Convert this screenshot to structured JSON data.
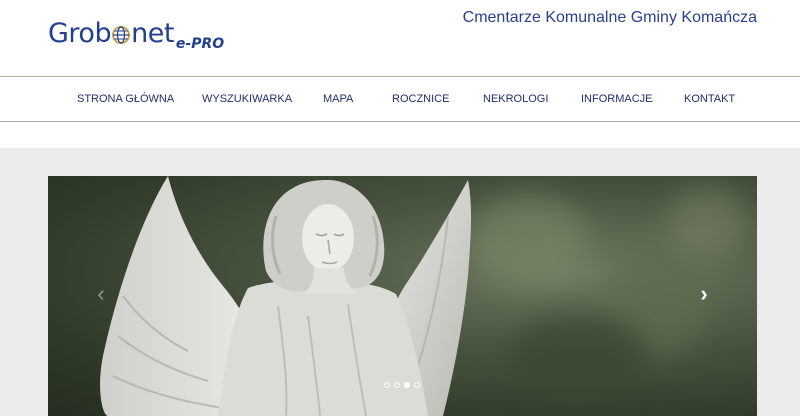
{
  "header": {
    "logo": {
      "main_prefix": "Grob",
      "main_suffix": "net",
      "sub": "e-PRO",
      "brand_color": "#233f8e"
    },
    "site_title": "Cmentarze Komunalne Gminy Komańcza"
  },
  "nav": {
    "items": [
      {
        "label": "STRONA GŁÓWNA"
      },
      {
        "label": "WYSZUKIWARKA"
      },
      {
        "label": "MAPA"
      },
      {
        "label": "ROCZNICE"
      },
      {
        "label": "NEKROLOGI"
      },
      {
        "label": "INFORMACJE"
      },
      {
        "label": "KONTAKT"
      }
    ],
    "text_color": "#1f2f6e"
  },
  "slider": {
    "image": "angel-statue",
    "prev_icon": "chevron-left-icon",
    "next_icon": "chevron-right-icon",
    "slides_count": 4,
    "active_slide": 3
  },
  "colors": {
    "rule": "#b8b3a4",
    "band": "#ececec"
  }
}
